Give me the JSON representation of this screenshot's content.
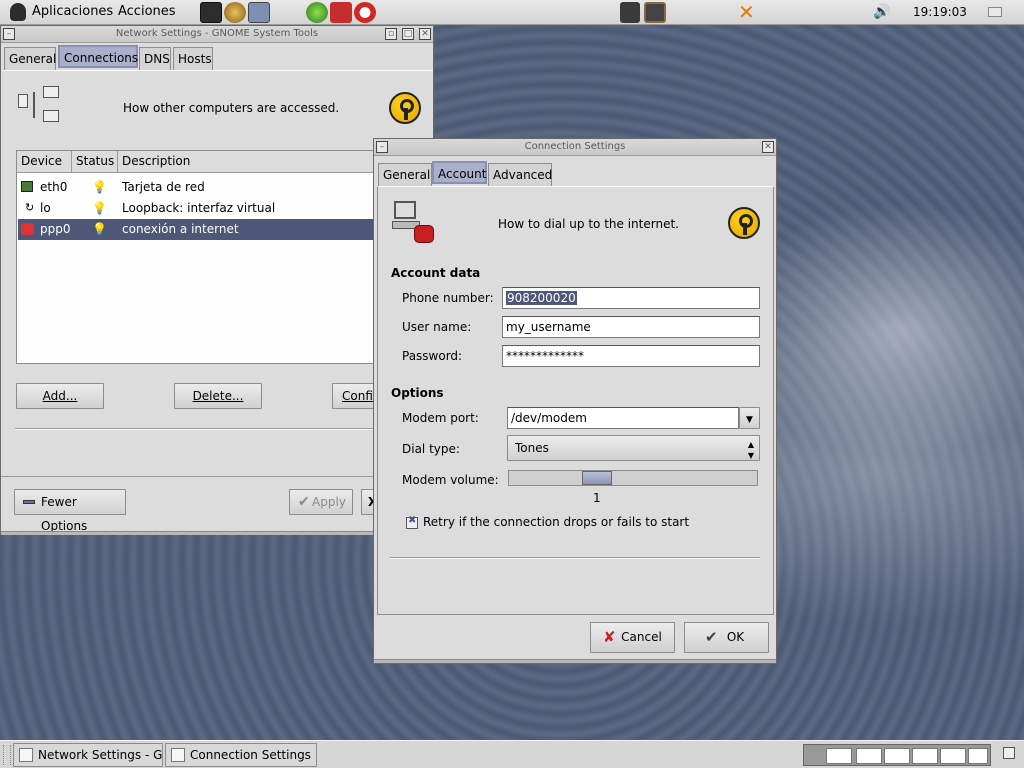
{
  "top_panel": {
    "menus": [
      "Aplicaciones",
      "Acciones"
    ],
    "clock": "19:19:03"
  },
  "network_window": {
    "title": "Network Settings - GNOME System Tools",
    "tabs": [
      "General",
      "Connections",
      "DNS",
      "Hosts"
    ],
    "active_tab": "Connections",
    "intro": "How other computers are accessed.",
    "columns": [
      "Device",
      "Status",
      "Description"
    ],
    "rows": [
      {
        "device": "eth0",
        "description": "Tarjeta de red"
      },
      {
        "device": "lo",
        "description": "Loopback: interfaz virtual"
      },
      {
        "device": "ppp0",
        "description": "conexión a internet"
      }
    ],
    "buttons": {
      "add": "Add...",
      "delete": "Delete...",
      "configure": "Confi"
    },
    "fewer_options": "Fewer Options",
    "apply": "Apply",
    "close_partial": "X"
  },
  "connection_dialog": {
    "title": "Connection Settings",
    "tabs": [
      "General",
      "Account",
      "Advanced"
    ],
    "active_tab": "Account",
    "intro": "How to dial up to the internet.",
    "account_heading": "Account data",
    "phone_label": "Phone number:",
    "phone_value": "908200020",
    "user_label": "User name:",
    "user_value": "my_username",
    "password_label": "Password:",
    "password_value": "*************",
    "options_heading": "Options",
    "modem_port_label": "Modem port:",
    "modem_port_value": "/dev/modem",
    "dial_type_label": "Dial type:",
    "dial_type_value": "Tones",
    "modem_volume_label": "Modem volume:",
    "modem_volume_value": "1",
    "modem_volume_max": 3,
    "retry_label": "Retry if the connection drops or fails to start",
    "retry_checked": true,
    "cancel": "Cancel",
    "ok": "OK"
  },
  "taskbar": {
    "tasks": [
      "Network Settings - GNOME System Tools",
      "Connection Settings"
    ]
  },
  "colors": {
    "selection": "#4f5779",
    "active_tab": "#aab0c9",
    "key_icon": "#f5b800"
  }
}
